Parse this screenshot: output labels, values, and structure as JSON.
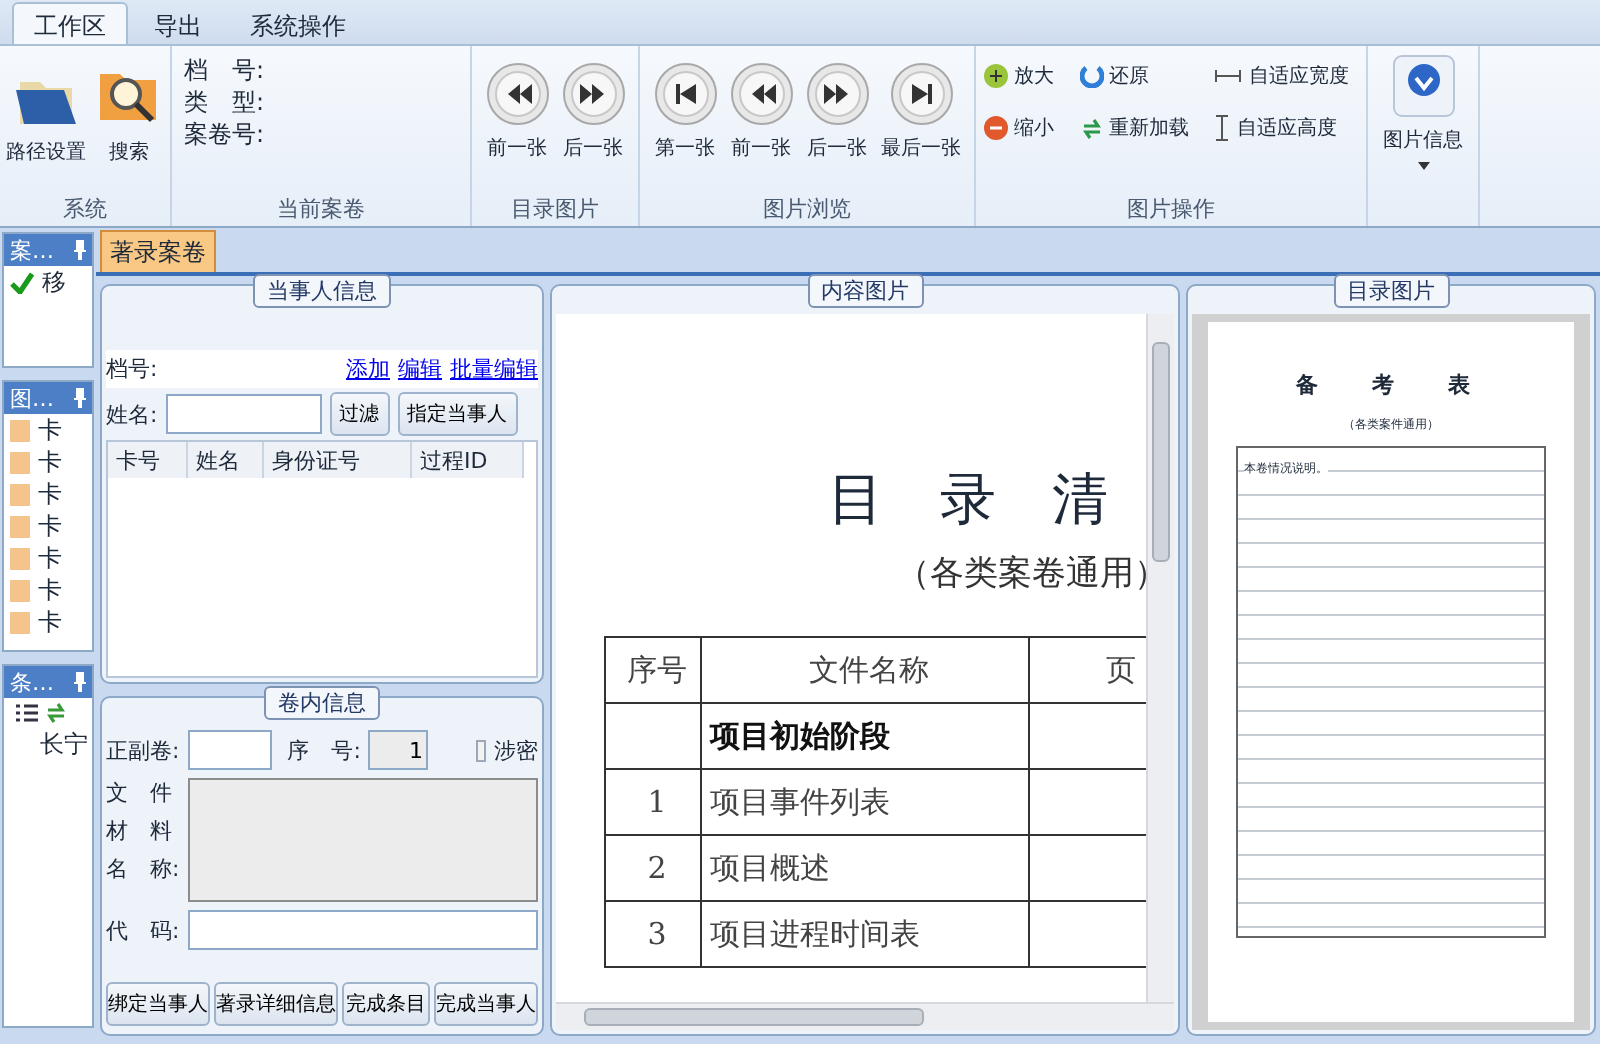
{
  "ribbon_tabs": [
    {
      "label": "工作区",
      "selected": true
    },
    {
      "label": "导出",
      "selected": false
    },
    {
      "label": "系统操作",
      "selected": false
    }
  ],
  "ribbon_groups": [
    {
      "title": "系统",
      "kind": "large",
      "buttons": [
        {
          "label": "路径设置",
          "kind": "folder"
        },
        {
          "label": "搜索",
          "kind": "search"
        }
      ]
    },
    {
      "title": "当前案卷",
      "kind": "fields",
      "fields": [
        "档　号:",
        "类　型:",
        "案卷号:"
      ]
    },
    {
      "title": "目录图片",
      "kind": "large",
      "buttons": [
        {
          "label": "前一张",
          "kind": "rewind"
        },
        {
          "label": "后一张",
          "kind": "forward"
        }
      ]
    },
    {
      "title": "图片浏览",
      "kind": "large",
      "buttons": [
        {
          "label": "第一张",
          "kind": "first"
        },
        {
          "label": "前一张",
          "kind": "rewind"
        },
        {
          "label": "后一张",
          "kind": "forward"
        },
        {
          "label": "最后一张",
          "kind": "last"
        }
      ]
    },
    {
      "title": "图片操作",
      "kind": "small",
      "buttons": [
        {
          "label": "放大",
          "kind": "zoom_in"
        },
        {
          "label": "缩小",
          "kind": "zoom_out"
        },
        {
          "label": "还原",
          "kind": "restore"
        },
        {
          "label": "重新加载",
          "kind": "reload"
        },
        {
          "label": "自适应宽度",
          "kind": "fit_width"
        },
        {
          "label": "自适应高度",
          "kind": "fit_height"
        }
      ]
    },
    {
      "kind": "menu",
      "buttons": [
        {
          "label": "图片信息",
          "kind": "info"
        }
      ]
    }
  ],
  "dock_panels": [
    {
      "title": "案…",
      "kind": "check",
      "items": [
        "移"
      ]
    },
    {
      "title": "图…",
      "kind": "list",
      "items": [
        "卡",
        "卡",
        "卡",
        "卡",
        "卡",
        "卡",
        "卡"
      ]
    },
    {
      "title": "条…",
      "kind": "tree",
      "items": [
        "长宁"
      ]
    }
  ],
  "doc_tab": {
    "label": "著录案卷",
    "selected": true
  },
  "party": {
    "title": "当事人信息",
    "file_no_label": "档号:",
    "links": [
      "添加",
      "编辑",
      "批量编辑"
    ],
    "name_label": "姓名:",
    "buttons": [
      "过滤",
      "指定当事人"
    ],
    "columns": [
      "卡号",
      "姓名",
      "身份证号",
      "过程ID"
    ]
  },
  "volume": {
    "title": "卷内信息",
    "volume_label": "正副卷:",
    "seq_label": "序　号:",
    "seq_value": "1",
    "secret": {
      "label": "涉密",
      "checked": false
    },
    "material_label": [
      "文　件",
      "材　料",
      "名　称:"
    ],
    "code_label": "代　码:",
    "buttons": [
      "绑定当事人",
      "著录详细信息",
      "完成条目",
      "完成当事人"
    ]
  },
  "content": {
    "title": "内容图片",
    "doc_title": "目　录　清",
    "doc_subtitle": "（各类案卷通用）",
    "columns": [
      "序号",
      "文件名称",
      "页"
    ],
    "rows": [
      {
        "kind": "heading",
        "cells": [
          "",
          "项目初始阶段"
        ]
      },
      {
        "kind": "item",
        "cells": [
          "1",
          "项目事件列表"
        ]
      },
      {
        "kind": "item",
        "cells": [
          "2",
          "项目概述"
        ]
      },
      {
        "kind": "item",
        "cells": [
          "3",
          "项目进程时间表"
        ]
      }
    ]
  },
  "catalog": {
    "title": "目录图片",
    "doc_title": "备　考　表",
    "doc_subtitle": "（各类案件通用）",
    "note": "本卷情况说明。"
  }
}
